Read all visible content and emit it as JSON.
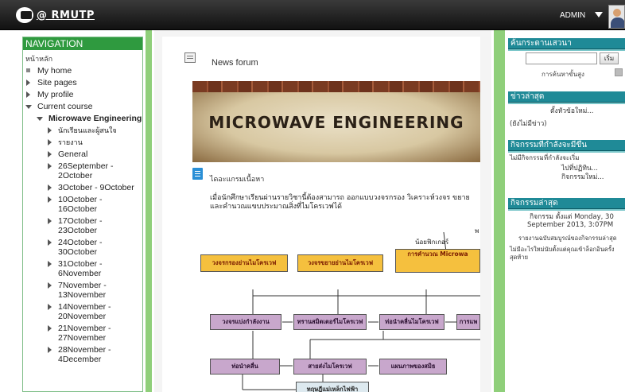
{
  "header": {
    "logo_text": "@ RMUTP",
    "user_name": "ADMIN"
  },
  "nav": {
    "title": "NAVIGATION",
    "home": "หน้าหลัก",
    "items": [
      {
        "label": "My home",
        "marker": "square",
        "level": 0
      },
      {
        "label": "Site pages",
        "marker": "right",
        "level": 0
      },
      {
        "label": "My profile",
        "marker": "right",
        "level": 0
      },
      {
        "label": "Current course",
        "marker": "down",
        "level": 0
      },
      {
        "label": "Microwave Engineering",
        "marker": "down",
        "level": 1,
        "bold": true
      },
      {
        "label": "นักเรียนและผู้สนใจ",
        "marker": "right",
        "level": 2,
        "thai": true
      },
      {
        "label": "รายงาน",
        "marker": "right",
        "level": 2,
        "thai": true
      },
      {
        "label": "General",
        "marker": "right",
        "level": 2
      },
      {
        "label": "26September - 2October",
        "marker": "right",
        "level": 2
      },
      {
        "label": "3October - 9October",
        "marker": "right",
        "level": 2
      },
      {
        "label": "10October - 16October",
        "marker": "right",
        "level": 2
      },
      {
        "label": "17October - 23October",
        "marker": "right",
        "level": 2
      },
      {
        "label": "24October - 30October",
        "marker": "right",
        "level": 2
      },
      {
        "label": "31October - 6November",
        "marker": "right",
        "level": 2
      },
      {
        "label": "7November - 13November",
        "marker": "right",
        "level": 2
      },
      {
        "label": "14November - 20November",
        "marker": "right",
        "level": 2
      },
      {
        "label": "21November - 27November",
        "marker": "right",
        "level": 2
      },
      {
        "label": "28November - 4December",
        "marker": "right",
        "level": 2
      }
    ]
  },
  "main": {
    "forum_link": "News forum",
    "banner_text": "MICROWAVE ENGINEERING",
    "doc_title": "ไดอะแกรมเนื้อหา",
    "description": "เมื่อนักศึกษาเรียนผ่านรายวิชานี้ต้องสามารถ ออกแบบวงจรกรอง วิเคราะห์วงจร ขยาย และคำนวณแขบประมาณสิ่งที่ไมโครเวฟได้",
    "diagram": {
      "label_top": "พ",
      "label_diode": "น้อยฟิกเกอร์",
      "boxes_yellow": [
        "วงจรกรองย่านไมโครเวฟ",
        "วงจรขยายย่านไมโครเวฟ",
        "การคำนวณ Microwa"
      ],
      "boxes_row2": [
        "วงจรแบ่งกำลังงาน",
        "ทรานสมิตเตอร์ไมโครเวฟ",
        "ท่อนำคลื่นไมโครเวฟ",
        "การแพ"
      ],
      "boxes_row3": [
        "ท่อนำคลื่น",
        "สายส่งไมโครเวฟ",
        "แผนภาพของสมิธ"
      ],
      "box_bottom": "ทฤษฎีแม่เหล็กไฟฟ้า"
    }
  },
  "right": {
    "search": {
      "title": "ค้นกระดานเสวนา",
      "button": "เริ่ม",
      "advanced": "การค้นหาขั้นสูง"
    },
    "news": {
      "title": "ข่าวล่าสุด",
      "add_topic": "ตั้งหัวข้อใหม่...",
      "empty": "(ยังไม่มีข่าว)"
    },
    "upcoming": {
      "title": "กิจกรรมที่กำลังจะมีขึ้น",
      "none": "ไม่มีกิจกรรมที่กำลังจะเริ่ม",
      "goto_calendar": "ไปที่ปฏิทิน...",
      "new_event": "กิจกรรมใหม่..."
    },
    "recent": {
      "title": "กิจกรรมล่าสุด",
      "since_line1": "กิจกรรม ตั้งแต่ Monday, 30",
      "since_line2": "September 2013, 3:07PM",
      "full_report": "รายงานฉบับสมบูรณ์ของกิจกรรมล่าสุด",
      "nothing_line1": "ไม่มีอะไรใหม่นับตั้งแต่คุณเข้าล็อกอินครั้ง",
      "nothing_line2": "สุดท้าย"
    }
  }
}
